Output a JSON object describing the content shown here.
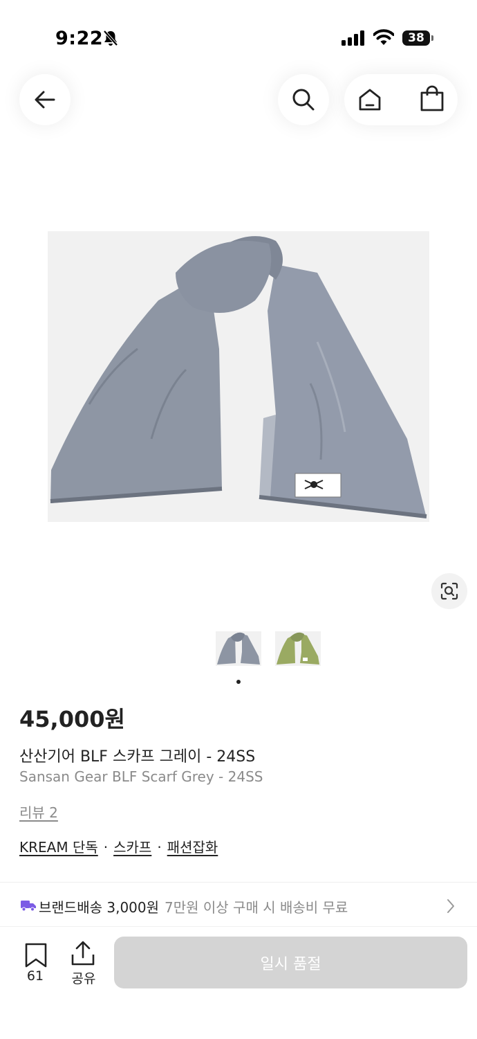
{
  "status_bar": {
    "time": "9:22",
    "battery": "38"
  },
  "product": {
    "price": "45,000원",
    "title_ko": "산산기어 BLF 스카프 그레이 - 24SS",
    "title_en": "Sansan Gear BLF Scarf Grey - 24SS",
    "reviews": "리뷰 2",
    "tags": [
      "KREAM 단독",
      "스카프",
      "패션잡화"
    ],
    "tag_separator": "·",
    "thumbnails": [
      {
        "name": "grey",
        "color": "#8d95a3"
      },
      {
        "name": "green",
        "color": "#9aaa62"
      }
    ],
    "image_color": "#8e96a4"
  },
  "shipping": {
    "label": "브랜드배송 3,000원",
    "note": "7만원 이상 구매 시 배송비 무료"
  },
  "bottom_bar": {
    "bookmark_count": "61",
    "share_label": "공유",
    "cta_label": "일시 품절"
  },
  "colors": {
    "truck": "#7b5be5",
    "cta_bg": "#d4d4d4"
  }
}
